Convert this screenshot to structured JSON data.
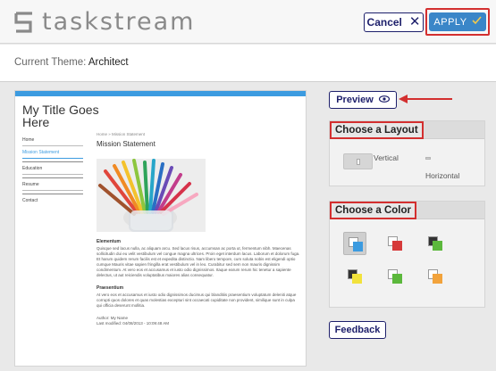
{
  "header": {
    "logo_text": "taskstream",
    "cancel_label": "Cancel",
    "apply_label": "APPLY"
  },
  "theme": {
    "label": "Current Theme:",
    "name": "Architect"
  },
  "preview": {
    "site_title": "My Title Goes Here",
    "nav_items": [
      "Home",
      "Mission Statement",
      "Education",
      "Resume",
      "Contact"
    ],
    "active_nav": "Mission Statement",
    "breadcrumb": "Home » Mission Statement",
    "heading": "Mission Statement",
    "section1_title": "Elementum",
    "section1_text": "Quisque sed lacus nulla, ac aliquam arcu. Sed lacus risus, accumsan ac porta ut, fermentum nibh. Maecenas sollicitudin dui eu velit vestibulum vel congue magna ultrices. Proin eget interdum lacus. Laborum et dolorum fuga. Et harum quidem rerum facilis est et expedita distinctio. Nam libero tempore, cum soluta nobis est eligendi optio cumque Mauris vitae sapien fringilla erat vestibulum vel in leo. Curabitur sed sem non mauris dignissim condimentum. At vero eos et accusamus et iusto odio dignissimos. Itaque earum rerum hic tenetur a sapiente delectus, ut aut reiciendis voluptatibus maiores alias consequatur.",
    "section2_title": "Praesentium",
    "section2_text": "At vero eos et accusamus et iusto odio dignissimos ducimus qui blanditiis praesentium voluptatum deleniti atque corrupti quos dolores et quas molestias excepturi sint occaecati cupiditate non provident, similique sunt in culpa qui officia deserunt mollitia.",
    "author_line": "Author: My Name",
    "modified_line": "Last modified: 04/08/2013 - 10:09:48 AM"
  },
  "right": {
    "preview_label": "Preview",
    "layout_title": "Choose a Layout",
    "layout_vertical": "Vertical",
    "layout_horizontal": "Horizontal",
    "color_title": "Choose a Color",
    "feedback_label": "Feedback"
  },
  "colors": {
    "swatches": [
      {
        "name": "blue",
        "back": "#ffffff",
        "front": "#3c9be0",
        "selected": true
      },
      {
        "name": "red",
        "back": "#ffffff",
        "front": "#d63a3a",
        "selected": false
      },
      {
        "name": "green-dark",
        "back": "#333333",
        "front": "#5cb83c",
        "selected": false
      },
      {
        "name": "yellow",
        "back": "#333333",
        "front": "#f2e23c",
        "selected": false
      },
      {
        "name": "green",
        "back": "#ffffff",
        "front": "#5cb83c",
        "selected": false
      },
      {
        "name": "orange",
        "back": "#ffffff",
        "front": "#f2a33c",
        "selected": false
      }
    ],
    "accent": "#3c9be0",
    "brand_navy": "#1d1f6b",
    "apply_blue": "#3a86c8",
    "highlight_red": "#d32f2f"
  },
  "icons": {
    "cancel": "close-icon",
    "apply": "checkmark-icon",
    "preview": "eye-icon"
  }
}
